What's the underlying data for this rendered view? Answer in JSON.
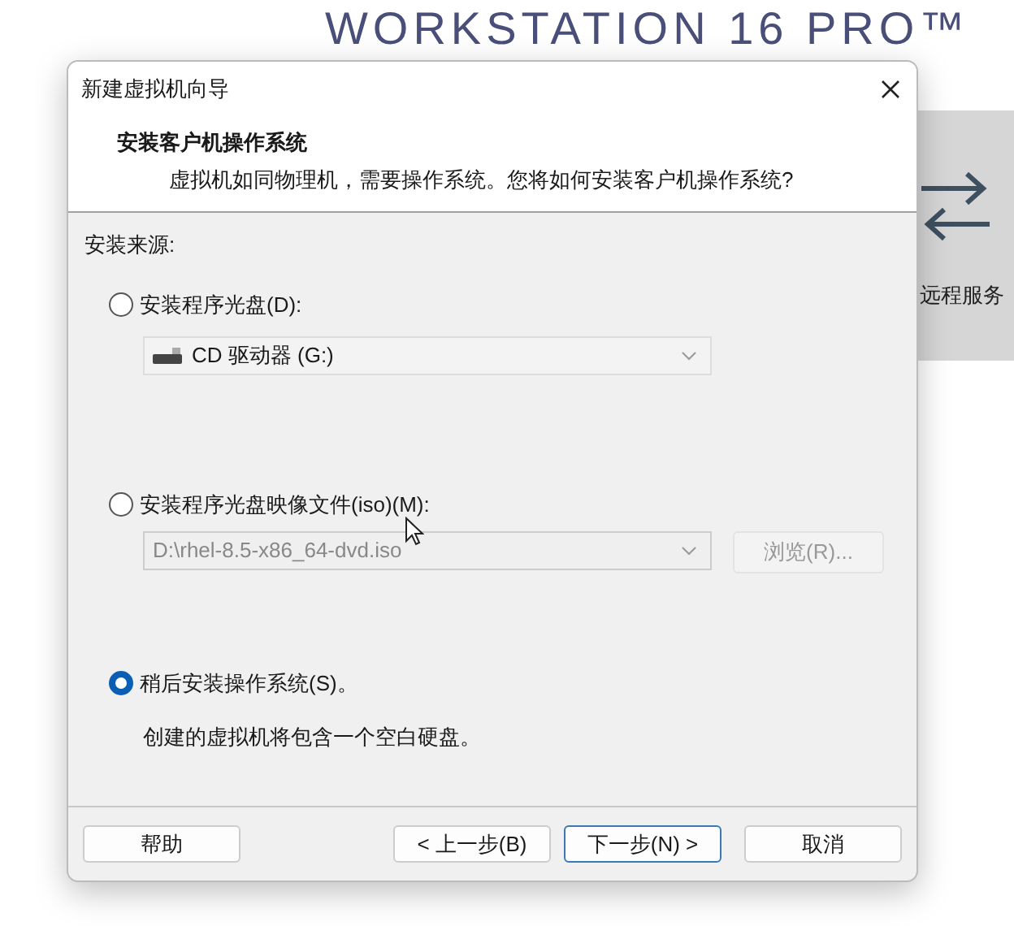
{
  "background": {
    "title": "WORKSTATION 16 PRO™",
    "tile_label": "远程服务"
  },
  "dialog": {
    "title": "新建虚拟机向导",
    "heading": "安装客户机操作系统",
    "subheading": "虚拟机如同物理机，需要操作系统。您将如何安装客户机操作系统?",
    "source_label": "安装来源:",
    "options": [
      {
        "kind": "drive",
        "label": "安装程序光盘(D):",
        "selected": false,
        "value": "CD 驱动器 (G:)",
        "disabled": false
      },
      {
        "kind": "iso",
        "label": "安装程序光盘映像文件(iso)(M):",
        "selected": false,
        "value": "D:\\rhel-8.5-x86_64-dvd.iso",
        "disabled": true,
        "browse": "浏览(R)..."
      },
      {
        "kind": "later",
        "label": "稍后安装操作系统(S)。",
        "selected": true,
        "note": "创建的虚拟机将包含一个空白硬盘。"
      }
    ],
    "buttons": [
      {
        "label": "帮助",
        "default": false
      },
      {
        "label": "< 上一步(B)",
        "default": false
      },
      {
        "label": "下一步(N) >",
        "default": true
      },
      {
        "label": "取消",
        "default": false
      }
    ]
  }
}
